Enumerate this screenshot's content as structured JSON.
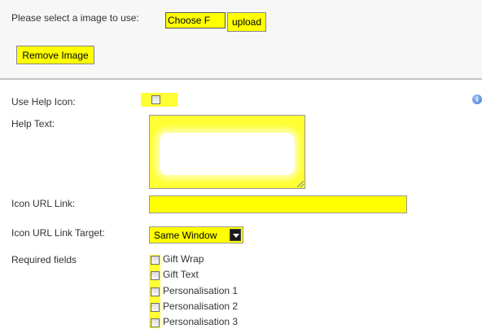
{
  "image_section": {
    "select_label": "Please select a image to use:",
    "choose_file_label": "Choose F",
    "upload_label": "upload",
    "remove_label": "Remove Image"
  },
  "help_icon": {
    "label": "Use Help Icon:",
    "checked": false,
    "info_icon": "info-icon"
  },
  "help_text": {
    "label": "Help Text:",
    "value": ""
  },
  "icon_url": {
    "label": "Icon URL Link:",
    "value": ""
  },
  "icon_url_target": {
    "label": "Icon URL Link Target:",
    "selected": "Same Window"
  },
  "required_fields": {
    "label": "Required fields",
    "options": [
      {
        "label": "Gift Wrap",
        "checked": false
      },
      {
        "label": "Gift Text",
        "checked": false
      },
      {
        "label": "Personalisation 1",
        "checked": false
      },
      {
        "label": "Personalisation 2",
        "checked": false
      },
      {
        "label": "Personalisation 3",
        "checked": false
      }
    ]
  },
  "colors": {
    "highlight": "#ffff00",
    "panel_bg": "#f7f7f7",
    "divider": "#c4c4c4",
    "text": "#333333"
  }
}
